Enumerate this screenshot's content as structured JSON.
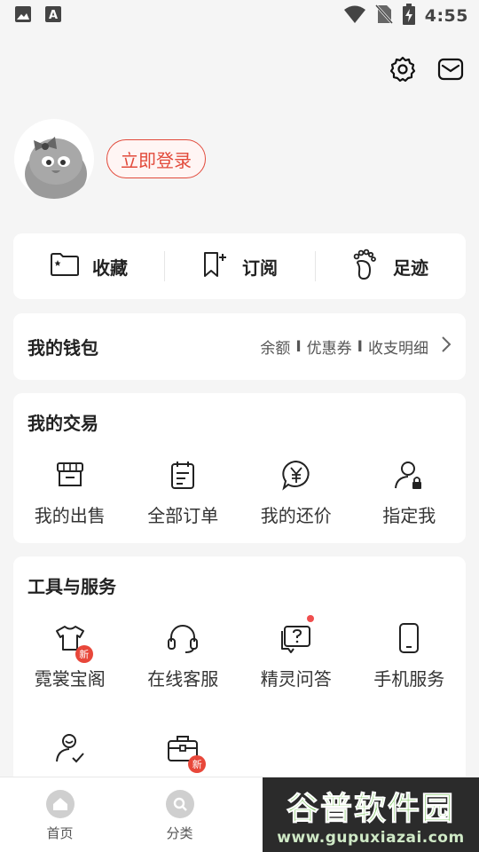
{
  "status_bar": {
    "time": "4:55",
    "left_icons": [
      "gallery-icon",
      "keyboard-a-icon"
    ],
    "right_icons": [
      "wifi-icon",
      "no-sim-icon",
      "battery-charging-icon"
    ]
  },
  "header": {
    "icons": [
      "settings-icon",
      "mail-icon"
    ]
  },
  "profile": {
    "login_label": "立即登录"
  },
  "quick_actions": [
    {
      "label": "收藏",
      "icon": "folder-star-icon"
    },
    {
      "label": "订阅",
      "icon": "bookmark-plus-icon"
    },
    {
      "label": "足迹",
      "icon": "footprint-icon"
    }
  ],
  "wallet": {
    "title": "我的钱包",
    "links": [
      "余额",
      "优惠券",
      "收支明细"
    ],
    "separator": "I"
  },
  "trade": {
    "title": "我的交易",
    "items": [
      {
        "label": "我的出售",
        "icon": "store-icon"
      },
      {
        "label": "全部订单",
        "icon": "order-list-icon"
      },
      {
        "label": "我的还价",
        "icon": "yen-bubble-icon"
      },
      {
        "label": "指定我",
        "icon": "user-lock-icon"
      }
    ]
  },
  "tools": {
    "title": "工具与服务",
    "items": [
      {
        "label": "霓裳宝阁",
        "icon": "tshirt-icon",
        "badge": "新"
      },
      {
        "label": "在线客服",
        "icon": "headset-icon"
      },
      {
        "label": "精灵问答",
        "icon": "question-bubble-icon",
        "dot": true
      },
      {
        "label": "手机服务",
        "icon": "phone-icon"
      },
      {
        "label": "",
        "icon": "user-check-icon"
      },
      {
        "label": "",
        "icon": "briefcase-icon",
        "badge": "新"
      }
    ]
  },
  "tabbar": [
    {
      "label": "首页",
      "icon": "home-icon"
    },
    {
      "label": "分类",
      "icon": "search-circle-icon"
    },
    {
      "label": "",
      "icon": ""
    },
    {
      "label": "",
      "icon": ""
    }
  ],
  "watermark": {
    "line1": "谷普软件园",
    "line2": "www.gupuxiazai.com"
  },
  "colors": {
    "accent": "#e24a3b",
    "background": "#f5f5f5",
    "card": "#ffffff"
  }
}
